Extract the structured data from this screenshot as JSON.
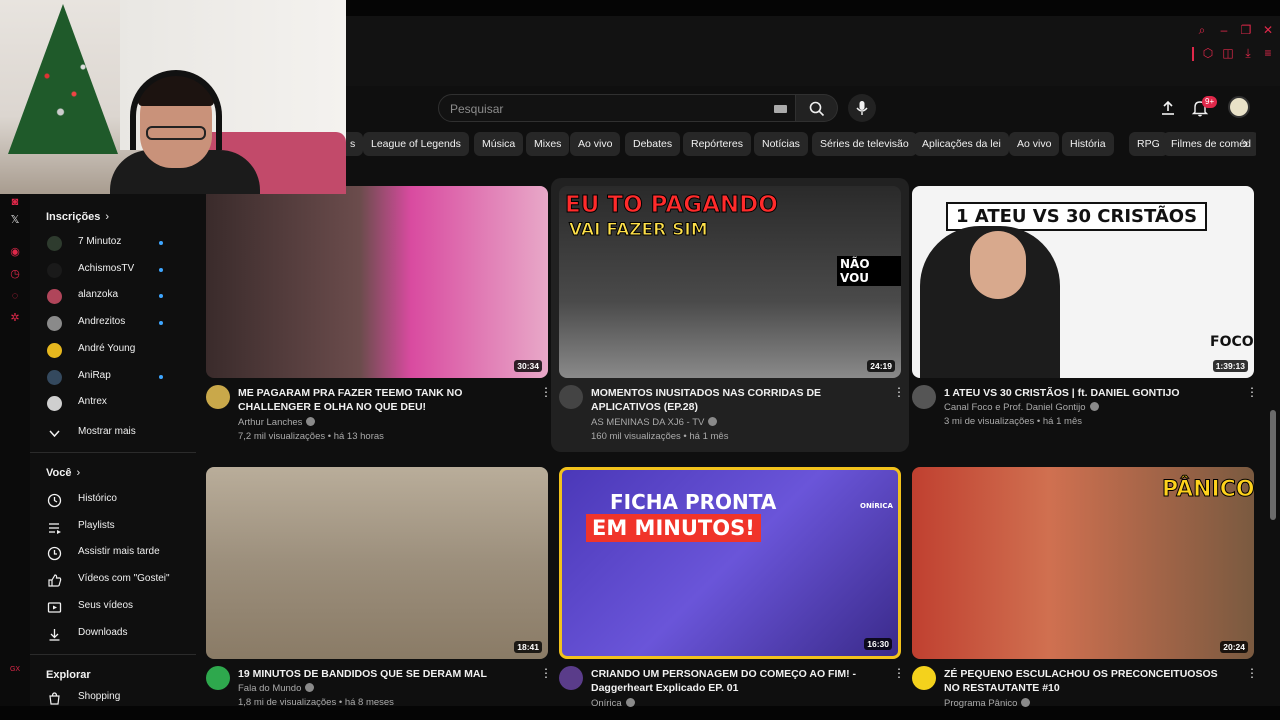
{
  "header": {
    "search_placeholder": "Pesquisar",
    "notification_badge": "9+"
  },
  "chips": [
    "s",
    "League of Legends",
    "Música",
    "Mixes",
    "Ao vivo",
    "Debates",
    "Repórteres",
    "Notícias",
    "Séries de televisão",
    "Aplicações da lei",
    "Ao vivo",
    "História",
    "RPG",
    "Filmes de coméd"
  ],
  "sidebar": {
    "subscriptions_title": "Inscrições",
    "subscriptions": [
      {
        "name": "7 Minutoz",
        "color": "#2e3b2e",
        "new": true
      },
      {
        "name": "AchismosTV",
        "color": "#1a1a1a",
        "new": true
      },
      {
        "name": "alanzoka",
        "color": "#b0455a",
        "new": true
      },
      {
        "name": "Andrezitos",
        "color": "#8a8a8a",
        "new": true
      },
      {
        "name": "André Young",
        "color": "#e6b71e",
        "new": false
      },
      {
        "name": "AniRap",
        "color": "#34495e",
        "new": true
      },
      {
        "name": "Antrex",
        "color": "#cfcfcf",
        "new": false
      }
    ],
    "show_more": "Mostrar mais",
    "you_title": "Você",
    "you_items": [
      {
        "label": "Histórico",
        "icon": "history-icon"
      },
      {
        "label": "Playlists",
        "icon": "playlists-icon"
      },
      {
        "label": "Assistir mais tarde",
        "icon": "watch-later-icon"
      },
      {
        "label": "Vídeos com \"Gostei\"",
        "icon": "like-icon"
      },
      {
        "label": "Seus vídeos",
        "icon": "your-videos-icon"
      },
      {
        "label": "Downloads",
        "icon": "downloads-icon"
      }
    ],
    "explore_title": "Explorar",
    "explore_items": [
      {
        "label": "Shopping",
        "icon": "shopping-icon"
      }
    ]
  },
  "videos": [
    {
      "title": "ME PAGARAM PRA FAZER TEEMO TANK NO CHALLENGER E OLHA NO QUE DEU!",
      "channel": "Arthur Lanches",
      "stats": "7,2 mil visualizações • há 13 horas",
      "duration": "30:34",
      "avatar_color": "#c9a84a",
      "thumb_color": "#7a3e63"
    },
    {
      "title": "MOMENTOS INUSITADOS NAS CORRIDAS DE APLICATIVOS (EP.28)",
      "channel": "AS MENINAS DA XJ6 - TV",
      "stats": "160 mil visualizações • há 1 mês",
      "duration": "24:19",
      "avatar_color": "#444444",
      "thumb_color": "#3d3d3d",
      "overlay_1": "EU TO PAGANDO",
      "overlay_2": "VAI FAZER SIM",
      "overlay_3": "NÃO VOU"
    },
    {
      "title": "1 ATEU VS 30 CRISTÃOS | ft. DANIEL GONTIJO",
      "channel": "Canal Foco e Prof. Daniel Gontijo",
      "stats": "3 mi de visualizações • há 1 mês",
      "duration": "1:39:13",
      "avatar_color": "#555555",
      "thumb_color": "#f2f2f2",
      "overlay_1": "1 ATEU VS 30 CRISTÃOS",
      "overlay_2": "FOCO"
    },
    {
      "title": "19 MINUTOS DE BANDIDOS QUE SE DERAM MAL",
      "channel": "Fala do Mundo",
      "stats": "1,8 mi de visualizações • há 8 meses",
      "duration": "18:41",
      "avatar_color": "#2ea84d",
      "thumb_color": "#9c8f7c"
    },
    {
      "title": "CRIANDO UM PERSONAGEM DO COMEÇO AO FIM! - Daggerheart Explicado EP. 01",
      "channel": "Onírica",
      "stats": "",
      "duration": "16:30",
      "avatar_color": "#5a3c8a",
      "thumb_color": "#5e48c9",
      "overlay_1": "FICHA PRONTA",
      "overlay_2": "EM MINUTOS!",
      "overlay_3": "ONÍRICA"
    },
    {
      "title": "ZÉ PEQUENO ESCULACHOU OS PRECONCEITUOSOS NO RESTAUTANTE #10",
      "channel": "Programa Pânico",
      "stats": "",
      "duration": "20:24",
      "avatar_color": "#f4d21c",
      "thumb_color": "#b46a4a",
      "overlay_1": "PÂNICO"
    }
  ],
  "colors": {
    "accent": "#e0284a",
    "background": "#0f0f0f"
  }
}
